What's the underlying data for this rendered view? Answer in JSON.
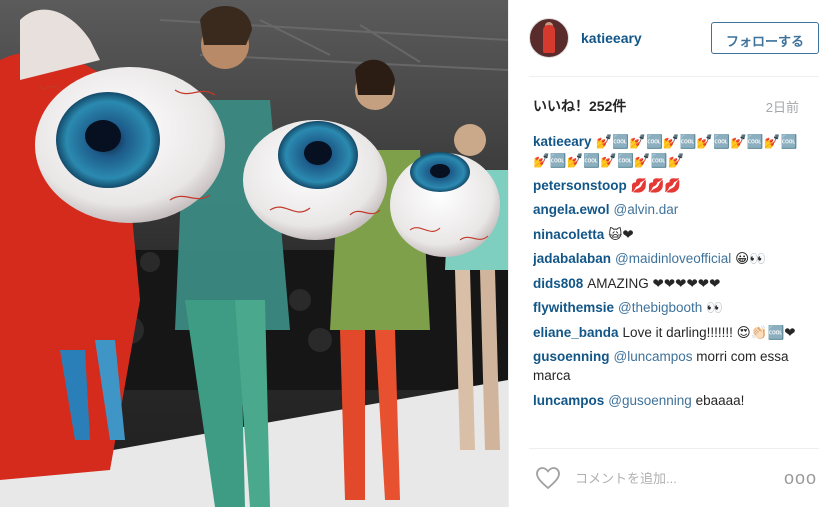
{
  "post": {
    "username": "katieeary",
    "follow_label": "フォローする",
    "likes": "いいね！252件",
    "time": "2日前"
  },
  "comments": [
    {
      "user": "katieeary",
      "mention": "",
      "text": "💅🆒💅🆒💅🆒💅🆒💅🆒💅🆒💅🆒💅🆒💅🆒💅🆒💅"
    },
    {
      "user": "petersonstoop",
      "mention": "",
      "text": "💋💋💋"
    },
    {
      "user": "angela.ewol",
      "mention": "@alvin.dar",
      "text": ""
    },
    {
      "user": "ninacoletta",
      "mention": "",
      "text": "🙀❤"
    },
    {
      "user": "jadabalaban",
      "mention": "@maidinloveofficial",
      "text": "😀👀"
    },
    {
      "user": "dids808",
      "mention": "",
      "text": "AMAZING ❤❤❤❤❤❤"
    },
    {
      "user": "flywithemsie",
      "mention": "@thebigbooth",
      "text": "👀"
    },
    {
      "user": "eliane_banda",
      "mention": "",
      "text": "Love it darling!!!!!!! 😍👏🏻🆒❤"
    },
    {
      "user": "gusoenning",
      "mention": "@luncampos",
      "text": "morri com essa marca"
    },
    {
      "user": "luncampos",
      "mention": "@gusoenning",
      "text": "ebaaaa!"
    }
  ],
  "footer": {
    "comment_placeholder": "コメントを追加...",
    "more_label": "ooo",
    "like_icon": "heart-icon",
    "more_icon": "more-options-icon"
  },
  "colors": {
    "username": "#125688",
    "mention": "#3f729b",
    "follow_border": "#3f729b"
  }
}
